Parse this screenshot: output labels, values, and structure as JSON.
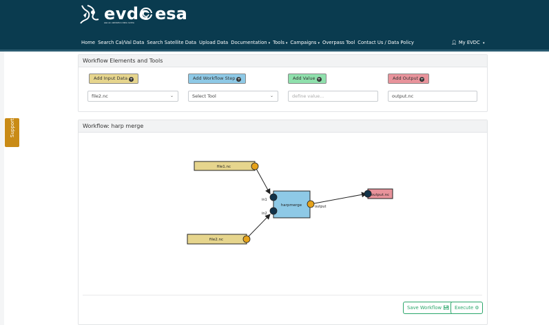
{
  "header": {
    "logo_evdc": "evdc",
    "logo_evdc_sub": "esa eo validation data centre",
    "logo_esa": "esa",
    "nav": [
      {
        "label": "Home",
        "dropdown": false
      },
      {
        "label": "Search Cal/Val Data",
        "dropdown": false
      },
      {
        "label": "Search Satellite Data",
        "dropdown": false
      },
      {
        "label": "Upload Data",
        "dropdown": false
      },
      {
        "label": "Documentation",
        "dropdown": true
      },
      {
        "label": "Tools",
        "dropdown": true
      },
      {
        "label": "Campaigns",
        "dropdown": true
      },
      {
        "label": "Overpass Tool",
        "dropdown": false
      },
      {
        "label": "Contact Us / Data Policy",
        "dropdown": false
      }
    ],
    "account_label": "My EVDC"
  },
  "support_label": "Support",
  "tools_panel": {
    "title": "Workflow Elements and Tools",
    "add_input_label": "Add Input Data",
    "add_step_label": "Add Workflow Step",
    "add_value_label": "Add Value",
    "add_output_label": "Add Output",
    "input_select_value": "file2.nc",
    "tool_select_value": "Select Tool",
    "value_placeholder": "define value...",
    "output_value": "output.nc"
  },
  "workflow_panel": {
    "title": "Workflow: harp merge",
    "nodes": {
      "file1": "file1.nc",
      "file2": "file2.nc",
      "tool": "harpmerge",
      "output": "output.nc"
    },
    "ports": {
      "in1": "in1",
      "in2": "in2",
      "output": "output"
    },
    "save_label": "Save Workflow",
    "execute_label": "Execute"
  },
  "colors": {
    "header_bg": "#0a3b4f",
    "input_node": "#e6d58d",
    "tool_node": "#8ec9e6",
    "output_node": "#e8939b",
    "port_in": "#12334a",
    "port_out": "#e5a21a",
    "add_input_btn": "#e6d58d",
    "add_step_btn": "#8ec9e6",
    "add_value_btn": "#8fe0ac",
    "add_output_btn": "#e8939b",
    "success": "#2aa66a",
    "support": "#c98b16"
  }
}
